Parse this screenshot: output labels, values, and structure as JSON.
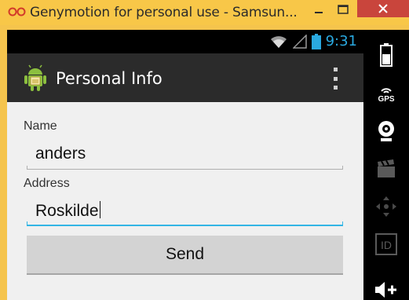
{
  "window": {
    "title": "Genymotion for personal use - Samsun...",
    "logo": "genymotion-logo-icon",
    "minimize": "—",
    "maximize": "☐",
    "close": "✕"
  },
  "statusbar": {
    "time": "9:31",
    "icons": [
      "wifi-icon",
      "signal-icon",
      "battery-icon"
    ]
  },
  "actionbar": {
    "title": "Personal Info",
    "app_icon": "android-icon",
    "overflow": "overflow-menu-icon"
  },
  "form": {
    "name_label": "Name",
    "name_value": "anders",
    "address_label": "Address",
    "address_value": "Roskilde",
    "send_label": "Send"
  },
  "sidebar": {
    "icons": [
      "battery-icon",
      "gps-icon",
      "camera-icon",
      "clapperboard-icon",
      "dpad-icon",
      "id-icon",
      "volume-up-icon"
    ],
    "gps_label": "GPS",
    "id_label": "ID"
  },
  "colors": {
    "titlebar": "#f8c748",
    "close": "#c9453c",
    "accent": "#33b5e5",
    "time": "#2aa9e0"
  }
}
